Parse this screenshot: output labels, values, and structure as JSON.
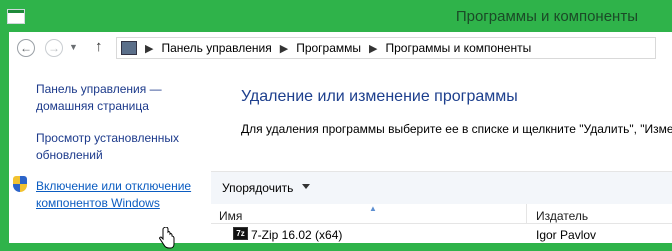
{
  "window": {
    "title": "Программы и компоненты"
  },
  "nav": {
    "breadcrumbs": [
      "Панель управления",
      "Программы",
      "Программы и компоненты"
    ]
  },
  "sidebar": {
    "items": [
      {
        "label_line1": "Панель управления —",
        "label_line2": "домашняя страница"
      },
      {
        "label_line1": "Просмотр установленных",
        "label_line2": "обновлений"
      },
      {
        "label_line1": "Включение или отключение",
        "label_line2": "компонентов Windows"
      }
    ]
  },
  "main": {
    "title": "Удаление или изменение программы",
    "description": "Для удаления программы выберите ее в списке и щелкните \"Удалить\", \"Изме"
  },
  "toolbar": {
    "organize_label": "Упорядочить"
  },
  "table": {
    "headers": {
      "name": "Имя",
      "publisher": "Издатель"
    },
    "rows": [
      {
        "name": "7-Zip 16.02 (x64)",
        "publisher": "Igor Pavlov",
        "icon_text": "7z"
      }
    ]
  },
  "colors": {
    "titlebar": "#2fb34a",
    "link": "#1c3a8b",
    "title": "#1d3f8d"
  },
  "icons": [
    "app-icon",
    "back-icon",
    "forward-icon",
    "up-icon",
    "folder-icon",
    "shield-icon",
    "cursor-icon",
    "zip-icon"
  ]
}
